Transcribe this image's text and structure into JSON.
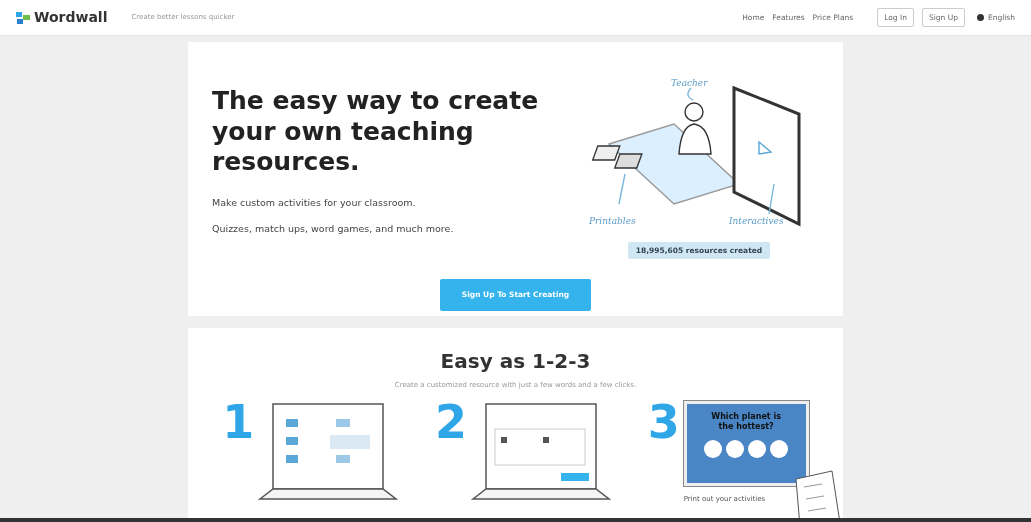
{
  "header": {
    "logo": "Wordwall",
    "tagline": "Create better lessons quicker",
    "nav": [
      {
        "label": "Home"
      },
      {
        "label": "Features"
      },
      {
        "label": "Price Plans"
      }
    ],
    "buttons": [
      "Log In",
      "Sign Up"
    ],
    "language": "English"
  },
  "hero": {
    "title": "The easy way to create your own teaching resources.",
    "lines": [
      "Make custom activities for your classroom.",
      "Quizzes, match ups, word games, and much more."
    ],
    "illustration_labels": [
      "Teacher",
      "Printables",
      "Interactives"
    ],
    "counter": "18,995,605 resources created",
    "cta": "Sign Up To Start Creating"
  },
  "steps_section": {
    "title": "Easy as 1-2-3",
    "subtitle": "Create a customized resource with just a few words and a few clicks.",
    "steps": [
      {
        "number": "1",
        "kind": "templates"
      },
      {
        "number": "2",
        "kind": "editor"
      },
      {
        "number": "3",
        "kind": "display",
        "question": "Which planet is the hottest?",
        "caption": "Print out your activities"
      }
    ]
  }
}
